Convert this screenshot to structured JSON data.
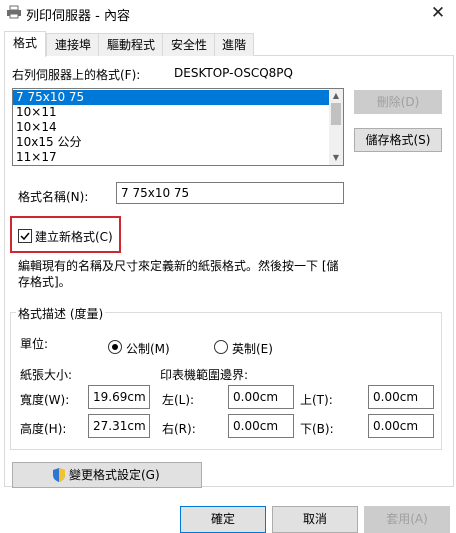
{
  "window": {
    "title": "列印伺服器 - 內容",
    "close_glyph": "✕"
  },
  "tabs": [
    "格式",
    "連接埠",
    "驅動程式",
    "安全性",
    "進階"
  ],
  "forms_label": "右列伺服器上的格式(F):",
  "server_name": "DESKTOP-OSCQ8PQ",
  "forms_list": [
    "7 75x10 75",
    "10×11",
    "10×14",
    "10x15 公分",
    "11×17"
  ],
  "buttons": {
    "delete": "刪除(D)",
    "save_form": "儲存格式(S)",
    "change_settings": "變更格式設定(G)",
    "ok": "確定",
    "cancel": "取消",
    "apply": "套用(A)"
  },
  "form_name_label": "格式名稱(N):",
  "form_name_value": "7 75x10 75",
  "create_new_form": "建立新格式(C)",
  "description": "編輯現有的名稱及尺寸來定義新的紙張格式。然後按一下 [儲存格式]。",
  "group": {
    "title": "格式描述 (度量)",
    "units_label": "單位:",
    "metric": "公制(M)",
    "english": "英制(E)",
    "paper_size": "紙張大小:",
    "printer_margins": "印表機範圍邊界:",
    "width_label": "寬度(W):",
    "width_value": "19.69cm",
    "height_label": "高度(H):",
    "height_value": "27.31cm",
    "left_label": "左(L):",
    "left_value": "0.00cm",
    "right_label": "右(R):",
    "right_value": "0.00cm",
    "top_label": "上(T):",
    "top_value": "0.00cm",
    "bottom_label": "下(B):",
    "bottom_value": "0.00cm"
  }
}
